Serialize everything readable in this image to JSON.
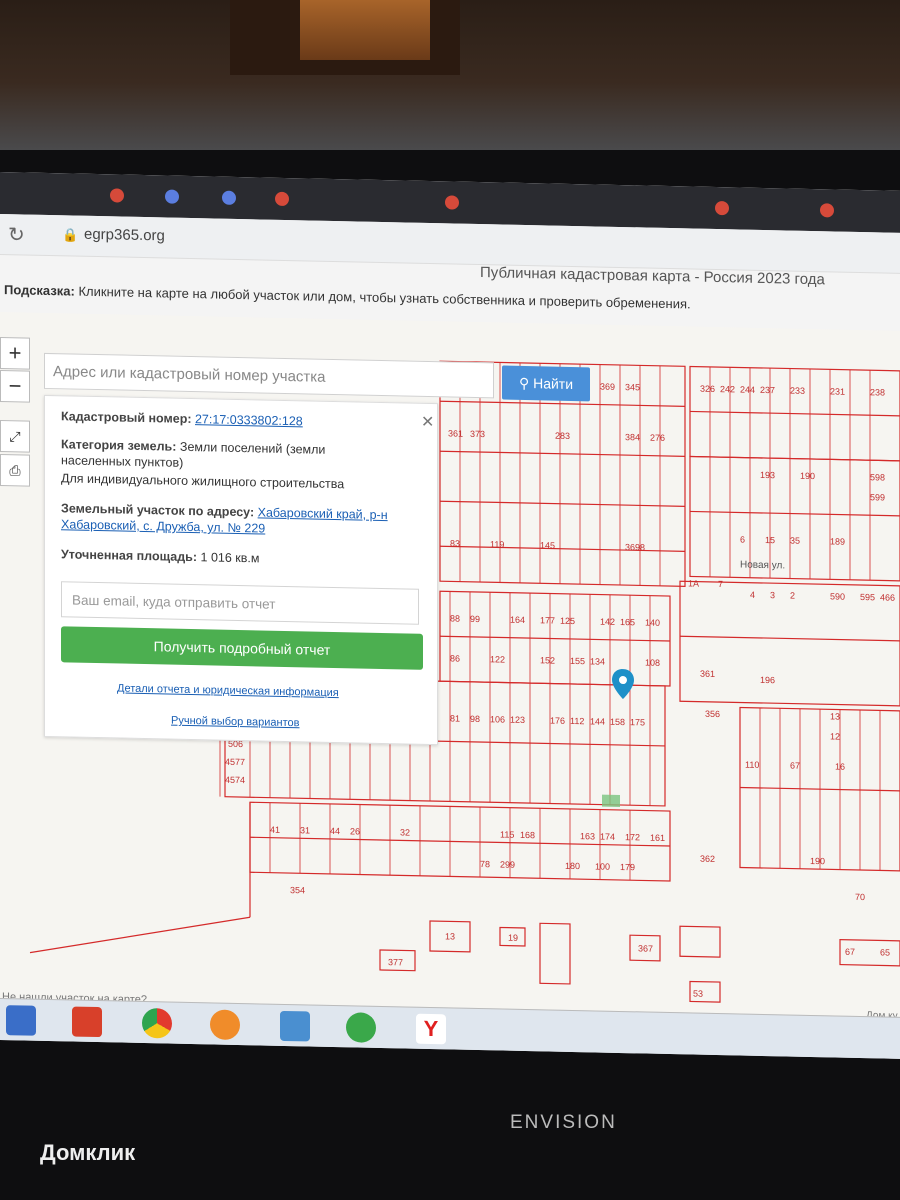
{
  "browser": {
    "url": "egrp365.org",
    "page_title": "Публичная кадастровая карта - Россия 2023 года"
  },
  "hint": {
    "label": "Подсказка:",
    "text": "Кликните на карте на любой участок или дом, чтобы узнать собственника и проверить обременения."
  },
  "search": {
    "placeholder": "Адрес или кадастровый номер участка",
    "button_label": "Найти"
  },
  "zoom": {
    "plus": "+",
    "minus": "−"
  },
  "parcel": {
    "cadastral_label": "Кадастровый номер:",
    "cadastral_number": "27:17:0333802:128",
    "category_label": "Категория земель:",
    "category_value": "Земли поселений (земли населенных пунктов)",
    "usage": "Для индивидуального жилищного строительства",
    "address_label": "Земельный участок по адресу:",
    "address_value": "Хабаровский край, р-н Хабаровский, с. Дружба, ул. № 229",
    "area_label": "Уточненная площадь:",
    "area_value": "1 016 кв.м"
  },
  "report": {
    "email_placeholder": "Ваш email, куда отправить отчет",
    "button_label": "Получить подробный отчет",
    "details_link": "Детали отчета и юридическая информация",
    "manual_link": "Ручной выбор вариантов"
  },
  "map_labels": {
    "street_1": "Новая ул.",
    "bottom_left": "Не нашли участок на карте?",
    "bottom_right": "Дом ку"
  },
  "monitor_brand": "ENVISION",
  "watermark": "Домклик",
  "colors": {
    "map_lines": "#d42a2a",
    "search_button": "#4a90d9",
    "report_button": "#4caf50",
    "marker": "#1e90c8"
  },
  "icons": [
    "reload-icon",
    "lock-icon",
    "close-icon",
    "marker-icon",
    "search-icon",
    "measure-icon",
    "print-icon"
  ]
}
